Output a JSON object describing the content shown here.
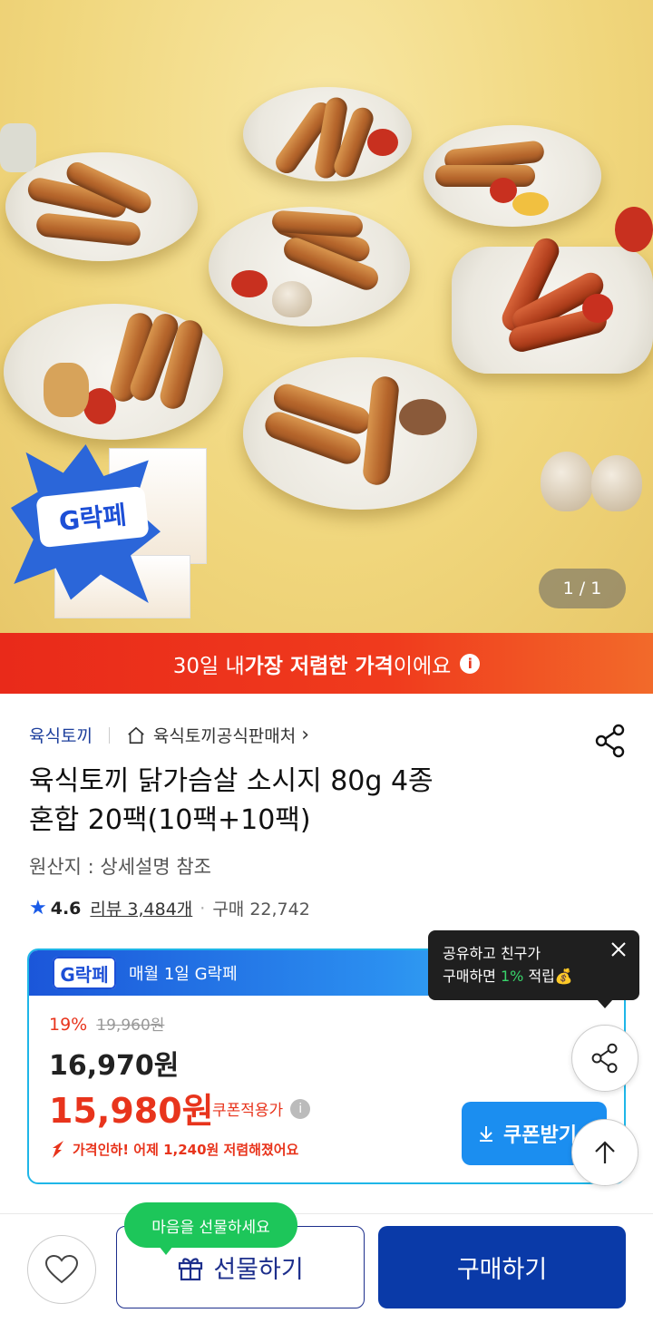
{
  "hero": {
    "counter": "1 / 1",
    "badge_text": "G락페"
  },
  "banner": {
    "pre": "30일 내 ",
    "bold": "가장 저렴한 가격",
    "post": "이에요",
    "info_icon": "i"
  },
  "product": {
    "brand": "육식토끼",
    "store": "육식토끼공식판매처",
    "store_chevron": "›",
    "title_line1": "육식토끼 닭가슴살 소시지 80g 4종",
    "title_line2": "혼합 20팩(10팩+10팩)",
    "origin": "원산지 : 상세설명 참조",
    "rating": "4.6",
    "reviews": "리뷰 3,484개",
    "purchases": "구매 22,742"
  },
  "price_card": {
    "badge": "G락페",
    "event_label": "매월 1일 G락페",
    "discount_pct": "19%",
    "original_price": "19,960원",
    "sale_price": "16,970원",
    "coupon_price": "15,980원",
    "coupon_label": "쿠폰적용가",
    "price_drop": "가격인하! 어제 1,240원 저렴해졌어요",
    "coupon_button": "쿠폰받기"
  },
  "tooltip": {
    "line1": "공유하고 친구가",
    "line2_pre": "구매하면 ",
    "line2_highlight": "1%",
    "line2_post": " 적립💰"
  },
  "bottom": {
    "gift_bubble": "마음을 선물하세요",
    "gift_button": "선물하기",
    "buy_button": "구매하기"
  },
  "colors": {
    "brand_red": "#e8341c",
    "brand_blue": "#0a3aa8",
    "accent_blue": "#1b8ef0",
    "green": "#1dc65a"
  },
  "icons": [
    "home-icon",
    "share-icon",
    "star-icon",
    "info-icon",
    "question-icon",
    "close-icon",
    "download-icon",
    "arrow-up-icon",
    "heart-icon",
    "gift-icon",
    "down-arrow-icon"
  ]
}
